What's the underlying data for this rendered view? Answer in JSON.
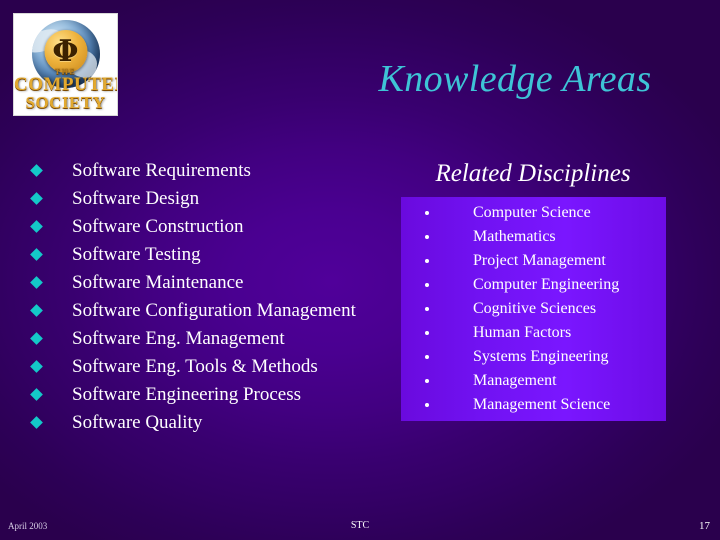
{
  "slide": {
    "title": "Knowledge Areas",
    "background_color_outer": "#2a004d",
    "background_color_center": "#50009a",
    "title_color": "#3ec4d6"
  },
  "logo": {
    "name": "ieee-computer-society-logo",
    "phi_symbol": "Φ",
    "line_the": "THE",
    "line_computer": "COMPUTER",
    "line_society": "SOCIETY",
    "gold_color": "#e2a92f"
  },
  "knowledge_areas": {
    "bullet_color": "#14c8c8",
    "items": [
      "Software Requirements",
      "Software Design",
      "Software Construction",
      "Software Testing",
      "Software Maintenance",
      "Software Configuration Management",
      "Software Eng. Management",
      "Software Eng. Tools & Methods",
      "Software Engineering Process",
      "Software Quality"
    ]
  },
  "related_disciplines": {
    "heading": "Related Disciplines",
    "panel_color": "#7a16ff",
    "bullet_color": "#ffffff",
    "items": [
      "Computer Science",
      "Mathematics",
      "Project Management",
      "Computer Engineering",
      "Cognitive Sciences",
      "Human Factors",
      "Systems Engineering",
      "Management",
      "Management Science"
    ]
  },
  "footer": {
    "date": "April 2003",
    "center": "STC",
    "page_number": "17"
  }
}
